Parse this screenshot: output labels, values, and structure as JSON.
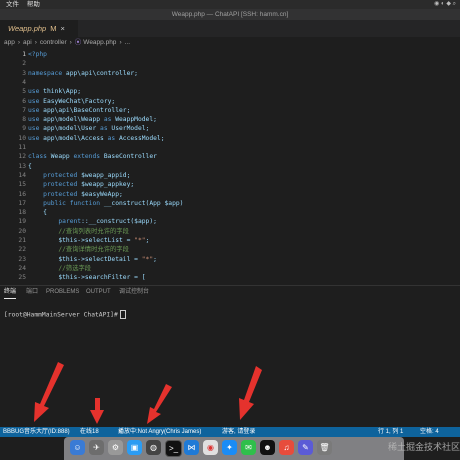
{
  "menubar": {
    "items": [
      "文件",
      "帮助"
    ]
  },
  "window": {
    "title": "Weapp.php — ChatAPI [SSH: hamm.cn]"
  },
  "tab": {
    "name": "Weapp.php",
    "modified": "M",
    "close": "×"
  },
  "breadcrumb": [
    "app",
    "api",
    "controller",
    "Weapp.php",
    "..."
  ],
  "code": [
    {
      "n": "1",
      "t": "<?php"
    },
    {
      "n": "2",
      "t": ""
    },
    {
      "n": "3",
      "t": "namespace app\\api\\controller;"
    },
    {
      "n": "4",
      "t": ""
    },
    {
      "n": "5",
      "t": "use think\\App;"
    },
    {
      "n": "6",
      "t": "use EasyWeChat\\Factory;"
    },
    {
      "n": "7",
      "t": "use app\\api\\BaseController;"
    },
    {
      "n": "8",
      "t": "use app\\model\\Weapp as WeappModel;"
    },
    {
      "n": "9",
      "t": "use app\\model\\User as UserModel;"
    },
    {
      "n": "10",
      "t": "use app\\model\\Access as AccessModel;"
    },
    {
      "n": "11",
      "t": ""
    },
    {
      "n": "12",
      "t": "class Weapp extends BaseController"
    },
    {
      "n": "13",
      "t": "{"
    },
    {
      "n": "14",
      "t": "    protected $weapp_appid;"
    },
    {
      "n": "15",
      "t": "    protected $weapp_appkey;"
    },
    {
      "n": "16",
      "t": "    protected $easyWeApp;"
    },
    {
      "n": "17",
      "t": "    public function __construct(App $app)"
    },
    {
      "n": "18",
      "t": "    {"
    },
    {
      "n": "19",
      "t": "        parent::__construct($app);"
    },
    {
      "n": "20",
      "t": "        //查询列表时允许的字段"
    },
    {
      "n": "21",
      "t": "        $this->selectList = \"*\";"
    },
    {
      "n": "22",
      "t": "        //查询详情时允许的字段"
    },
    {
      "n": "23",
      "t": "        $this->selectDetail = \"*\";"
    },
    {
      "n": "24",
      "t": "        //筛选字段"
    },
    {
      "n": "25",
      "t": "        $this->searchFilter = ["
    }
  ],
  "panel": {
    "tabs": [
      "终端",
      "端口",
      "PROBLEMS",
      "OUTPUT",
      "调试控制台"
    ],
    "terminal_prompt": "[root@HammMainServer ChatAPI]#"
  },
  "statusbar": {
    "room": "BBBUG音乐大厅(ID:888)",
    "online": "在线18",
    "playing": "播放中:Not Angry(Chris James)",
    "login": "游客, 请登录",
    "position": "行 1, 列 1",
    "spaces": "空格: 4"
  },
  "watermark": "稀土掘金技术社区",
  "colors": {
    "status_bg": "#0e639c",
    "keyword": "#569cd6",
    "comment": "#6a9955",
    "string": "#ce9178"
  }
}
